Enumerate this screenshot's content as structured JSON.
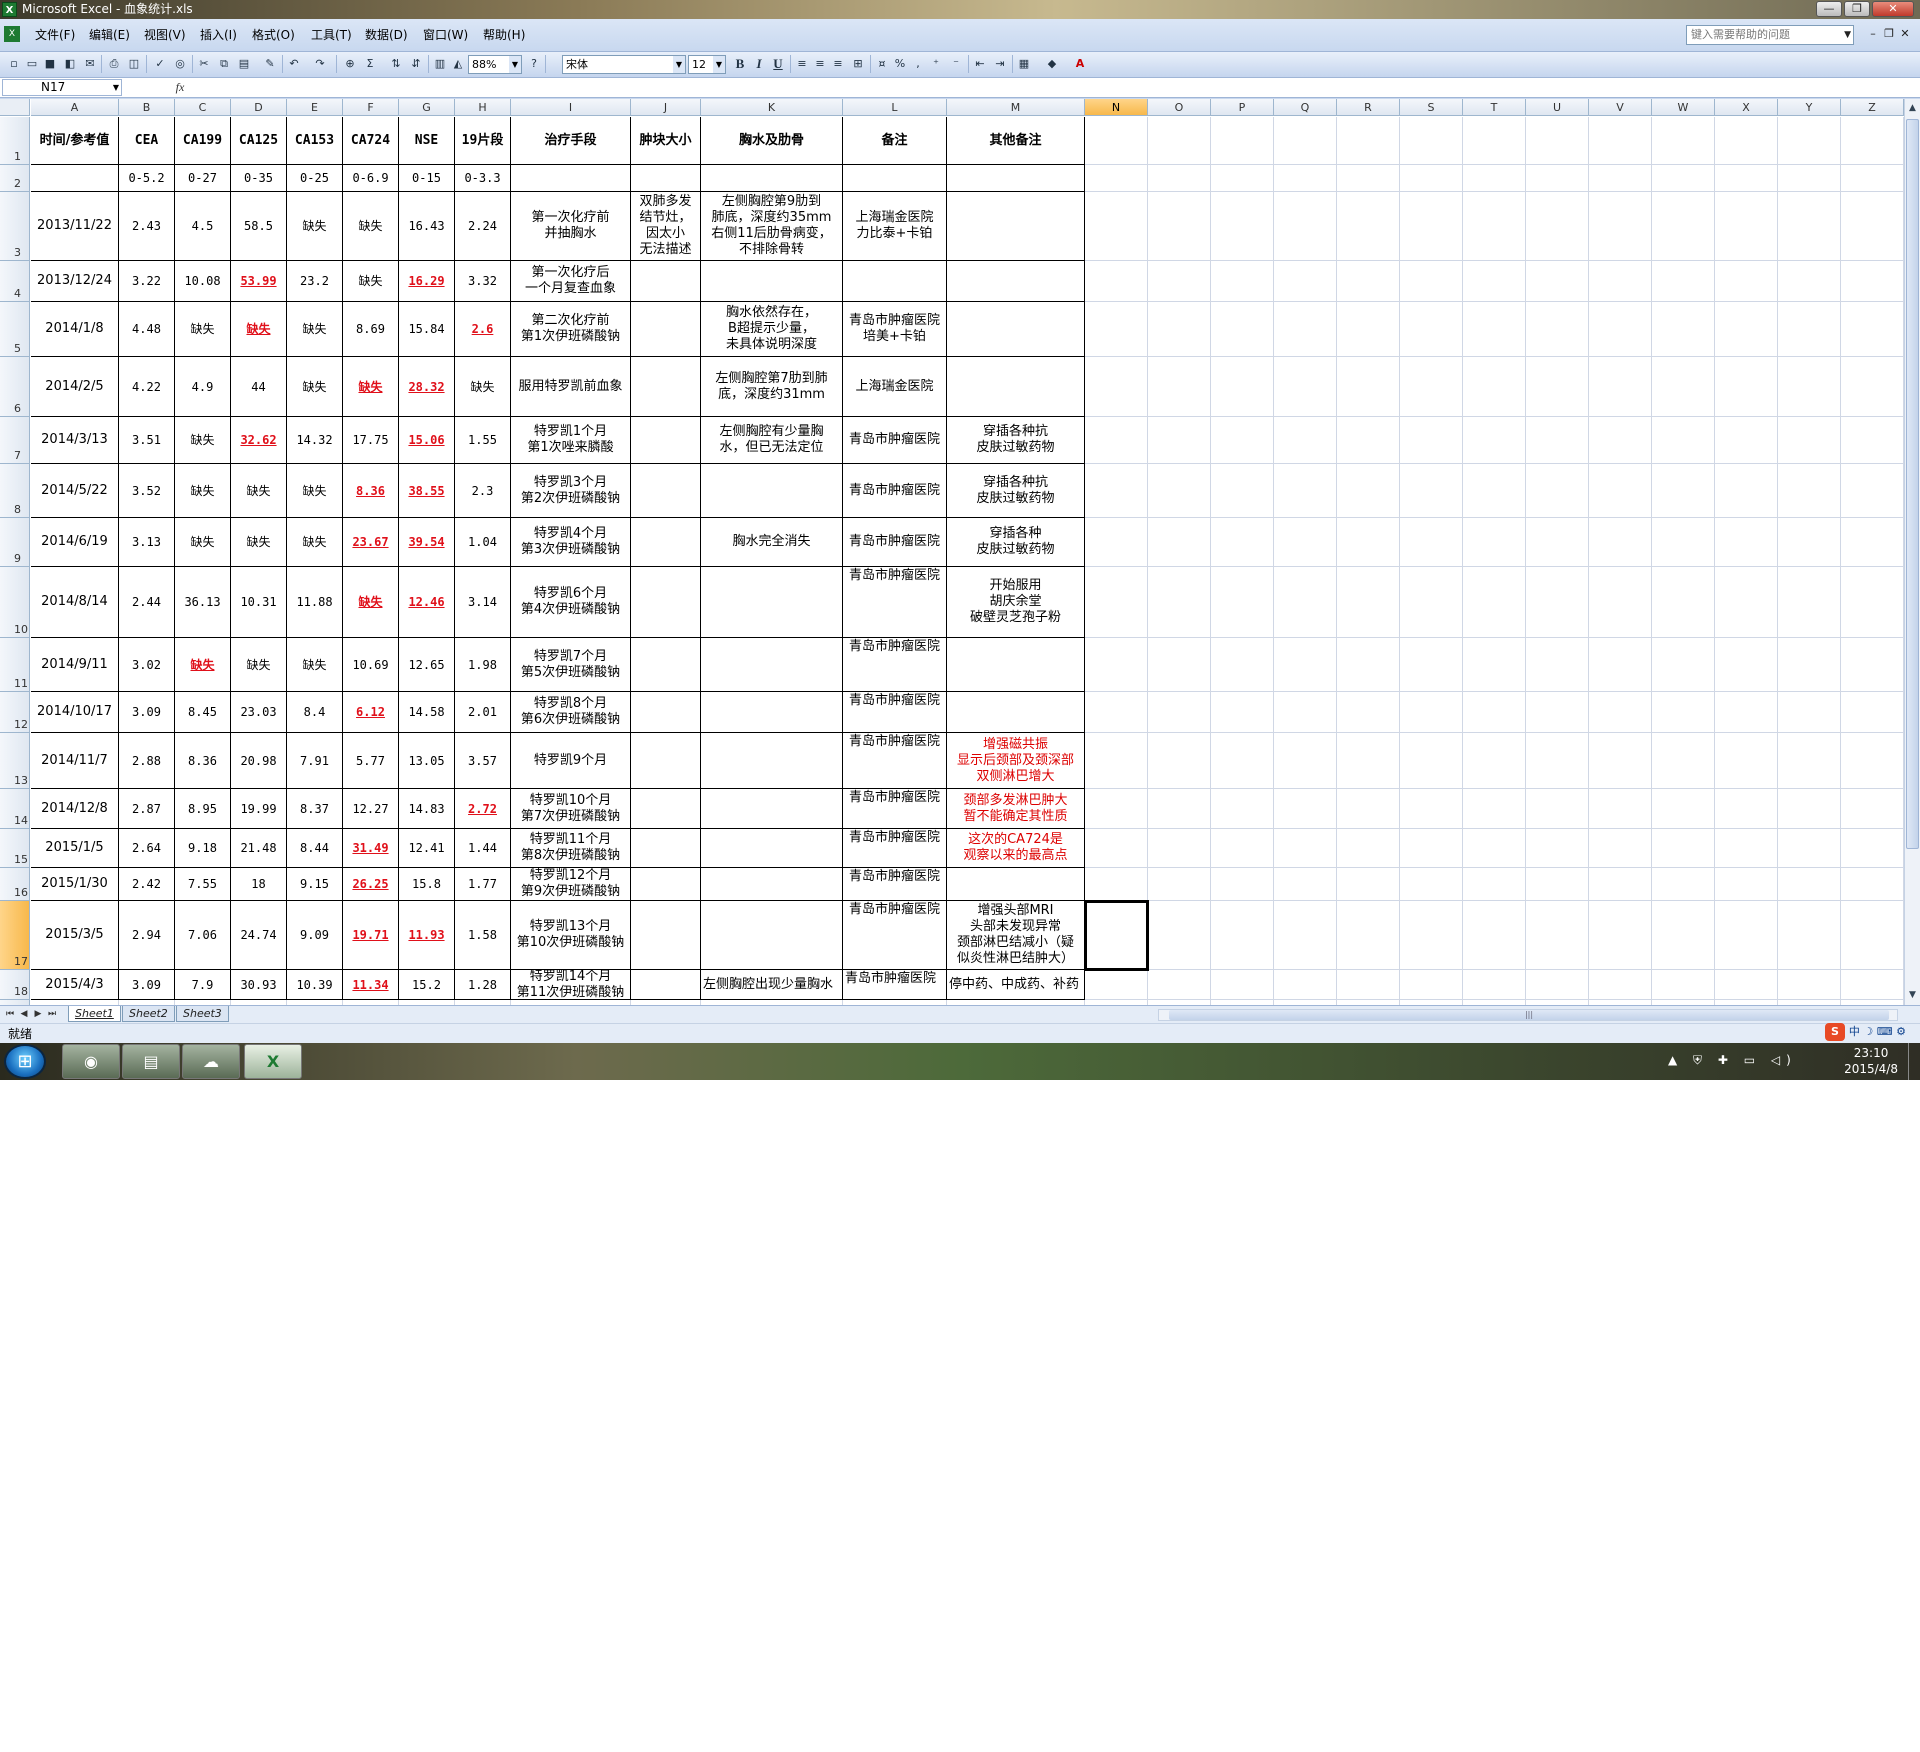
{
  "window": {
    "title": "Microsoft Excel - 血象统计.xls"
  },
  "menu": [
    "文件(F)",
    "编辑(E)",
    "视图(V)",
    "插入(I)",
    "格式(O)",
    "工具(T)",
    "数据(D)",
    "窗口(W)",
    "帮助(H)"
  ],
  "help_placeholder": "键入需要帮助的问题",
  "toolbar": {
    "zoom": "88%",
    "font": "宋体",
    "font_size": "12",
    "bold": "B",
    "italic": "I",
    "underline": "U",
    "percent": "%"
  },
  "namebox": "N17",
  "fx": "fx",
  "columns": [
    "A",
    "B",
    "C",
    "D",
    "E",
    "F",
    "G",
    "H",
    "I",
    "J",
    "K",
    "L",
    "M",
    "N",
    "O",
    "P",
    "Q",
    "R",
    "S",
    "T",
    "U",
    "V",
    "W",
    "X",
    "Y",
    "Z"
  ],
  "selected_column": "N",
  "selected_row": "17",
  "rows": [
    {
      "num": "1",
      "cells": [
        "时间/参考值",
        "CEA",
        "CA199",
        "CA125",
        "CA153",
        "CA724",
        "NSE",
        "19片段",
        "治疗手段",
        "肿块大小",
        "胸水及肋骨",
        "备注",
        "其他备注"
      ]
    },
    {
      "num": "2",
      "cells": [
        "",
        "0-5.2",
        "0-27",
        "0-35",
        "0-25",
        "0-6.9",
        "0-15",
        "0-3.3",
        "",
        "",
        "",
        "",
        ""
      ]
    },
    {
      "num": "3",
      "cells": [
        "2013/11/22",
        "2.43",
        "4.5",
        "58.5",
        "缺失",
        "缺失",
        "16.43",
        "2.24",
        "第一次化疗前\n并抽胸水",
        "双肺多发\n结节灶，\n因太小\n无法描述",
        "左侧胸腔第9肋到\n肺底，深度约35mm\n右侧11后肋骨病变，\n不排除骨转",
        "上海瑞金医院\n力比泰+卡铂",
        ""
      ]
    },
    {
      "num": "4",
      "cells": [
        "2013/12/24",
        "3.22",
        "10.08",
        "53.99",
        "23.2",
        "缺失",
        "16.29",
        "3.32",
        "第一次化疗后\n一个月复查血象",
        "",
        "",
        "",
        ""
      ]
    },
    {
      "num": "5",
      "cells": [
        "2014/1/8",
        "4.48",
        "缺失",
        "缺失",
        "缺失",
        "8.69",
        "15.84",
        "2.6",
        "第二次化疗前\n第1次伊班磷酸钠",
        "",
        "胸水依然存在，\nB超提示少量，\n未具体说明深度",
        "青岛市肿瘤医院\n培美+卡铂",
        ""
      ]
    },
    {
      "num": "6",
      "cells": [
        "2014/2/5",
        "4.22",
        "4.9",
        "44",
        "缺失",
        "缺失",
        "28.32",
        "缺失",
        "服用特罗凯前血象",
        "",
        "左侧胸腔第7肋到肺\n底，深度约31mm",
        "上海瑞金医院",
        ""
      ]
    },
    {
      "num": "7",
      "cells": [
        "2014/3/13",
        "3.51",
        "缺失",
        "32.62",
        "14.32",
        "17.75",
        "15.06",
        "1.55",
        "特罗凯1个月\n第1次唑来膦酸",
        "",
        "左侧胸腔有少量胸\n水，但已无法定位",
        "青岛市肿瘤医院",
        "穿插各种抗\n皮肤过敏药物"
      ]
    },
    {
      "num": "8",
      "cells": [
        "2014/5/22",
        "3.52",
        "缺失",
        "缺失",
        "缺失",
        "8.36",
        "38.55",
        "2.3",
        "特罗凯3个月\n第2次伊班磷酸钠",
        "",
        "",
        "青岛市肿瘤医院",
        "穿插各种抗\n皮肤过敏药物"
      ]
    },
    {
      "num": "9",
      "cells": [
        "2014/6/19",
        "3.13",
        "缺失",
        "缺失",
        "缺失",
        "23.67",
        "39.54",
        "1.04",
        "特罗凯4个月\n第3次伊班磷酸钠",
        "",
        "胸水完全消失",
        "青岛市肿瘤医院",
        "穿插各种\n皮肤过敏药物"
      ]
    },
    {
      "num": "10",
      "cells": [
        "2014/8/14",
        "2.44",
        "36.13",
        "10.31",
        "11.88",
        "缺失",
        "12.46",
        "3.14",
        "特罗凯6个月\n第4次伊班磷酸钠",
        "",
        "",
        "青岛市肿瘤医院",
        "开始服用\n胡庆余堂\n破壁灵芝孢子粉"
      ]
    },
    {
      "num": "11",
      "cells": [
        "2014/9/11",
        "3.02",
        "缺失",
        "缺失",
        "缺失",
        "10.69",
        "12.65",
        "1.98",
        "特罗凯7个月\n第5次伊班磷酸钠",
        "",
        "",
        "青岛市肿瘤医院",
        ""
      ]
    },
    {
      "num": "12",
      "cells": [
        "2014/10/17",
        "3.09",
        "8.45",
        "23.03",
        "8.4",
        "6.12",
        "14.58",
        "2.01",
        "特罗凯8个月\n第6次伊班磷酸钠",
        "",
        "",
        "青岛市肿瘤医院",
        ""
      ]
    },
    {
      "num": "13",
      "cells": [
        "2014/11/7",
        "2.88",
        "8.36",
        "20.98",
        "7.91",
        "5.77",
        "13.05",
        "3.57",
        "特罗凯9个月",
        "",
        "",
        "青岛市肿瘤医院",
        "增强磁共振\n显示后颈部及颈深部\n双侧淋巴增大"
      ]
    },
    {
      "num": "14",
      "cells": [
        "2014/12/8",
        "2.87",
        "8.95",
        "19.99",
        "8.37",
        "12.27",
        "14.83",
        "2.72",
        "特罗凯10个月\n第7次伊班磷酸钠",
        "",
        "",
        "青岛市肿瘤医院",
        "颈部多发淋巴肿大\n暂不能确定其性质"
      ]
    },
    {
      "num": "15",
      "cells": [
        "2015/1/5",
        "2.64",
        "9.18",
        "21.48",
        "8.44",
        "31.49",
        "12.41",
        "1.44",
        "特罗凯11个月\n第8次伊班磷酸钠",
        "",
        "",
        "青岛市肿瘤医院",
        "这次的CA724是\n观察以来的最高点"
      ]
    },
    {
      "num": "16",
      "cells": [
        "2015/1/30",
        "2.42",
        "7.55",
        "18",
        "9.15",
        "26.25",
        "15.8",
        "1.77",
        "特罗凯12个月\n第9次伊班磷酸钠",
        "",
        "",
        "青岛市肿瘤医院",
        ""
      ]
    },
    {
      "num": "17",
      "cells": [
        "2015/3/5",
        "2.94",
        "7.06",
        "24.74",
        "9.09",
        "19.71",
        "11.93",
        "1.58",
        "特罗凯13个月\n第10次伊班磷酸钠",
        "",
        "",
        "青岛市肿瘤医院",
        "增强头部MRI\n头部未发现异常\n颈部淋巴结减小（疑\n似炎性淋巴结肿大）"
      ]
    },
    {
      "num": "18",
      "cells": [
        "2015/4/3",
        "3.09",
        "7.9",
        "30.93",
        "10.39",
        "11.34",
        "15.2",
        "1.28",
        "特罗凯14个月\n第11次伊班磷酸钠",
        "",
        "左侧胸腔出现少量胸水",
        "青岛市肿瘤医院",
        "停中药、中成药、补药"
      ]
    },
    {
      "num": "19",
      "cells": [
        "",
        "",
        "",
        "",
        "",
        "",
        "",
        "",
        "",
        "",
        "",
        "",
        ""
      ]
    }
  ],
  "red_cells": [
    "3-3",
    "3-6",
    "4-3",
    "4-7",
    "5-5",
    "5-6",
    "6-3",
    "6-6",
    "7-5",
    "7-6",
    "8-5",
    "8-6",
    "9-5",
    "9-6",
    "10-2",
    "11-5",
    "13-7",
    "14-5",
    "15-5",
    "16-5",
    "16-6",
    "17-5",
    "18-5",
    "18-6"
  ],
  "red_note_rows": [
    "13",
    "14",
    "15"
  ],
  "sheets": [
    "Sheet1",
    "Sheet2",
    "Sheet3"
  ],
  "active_sheet": "Sheet1",
  "status": "就绪",
  "ime": "中",
  "clock": {
    "time": "23:10",
    "date": "2015/4/8"
  },
  "colors": {
    "red": "#e0101a",
    "selection": "#000000",
    "header_sel": "#f7b84b"
  }
}
